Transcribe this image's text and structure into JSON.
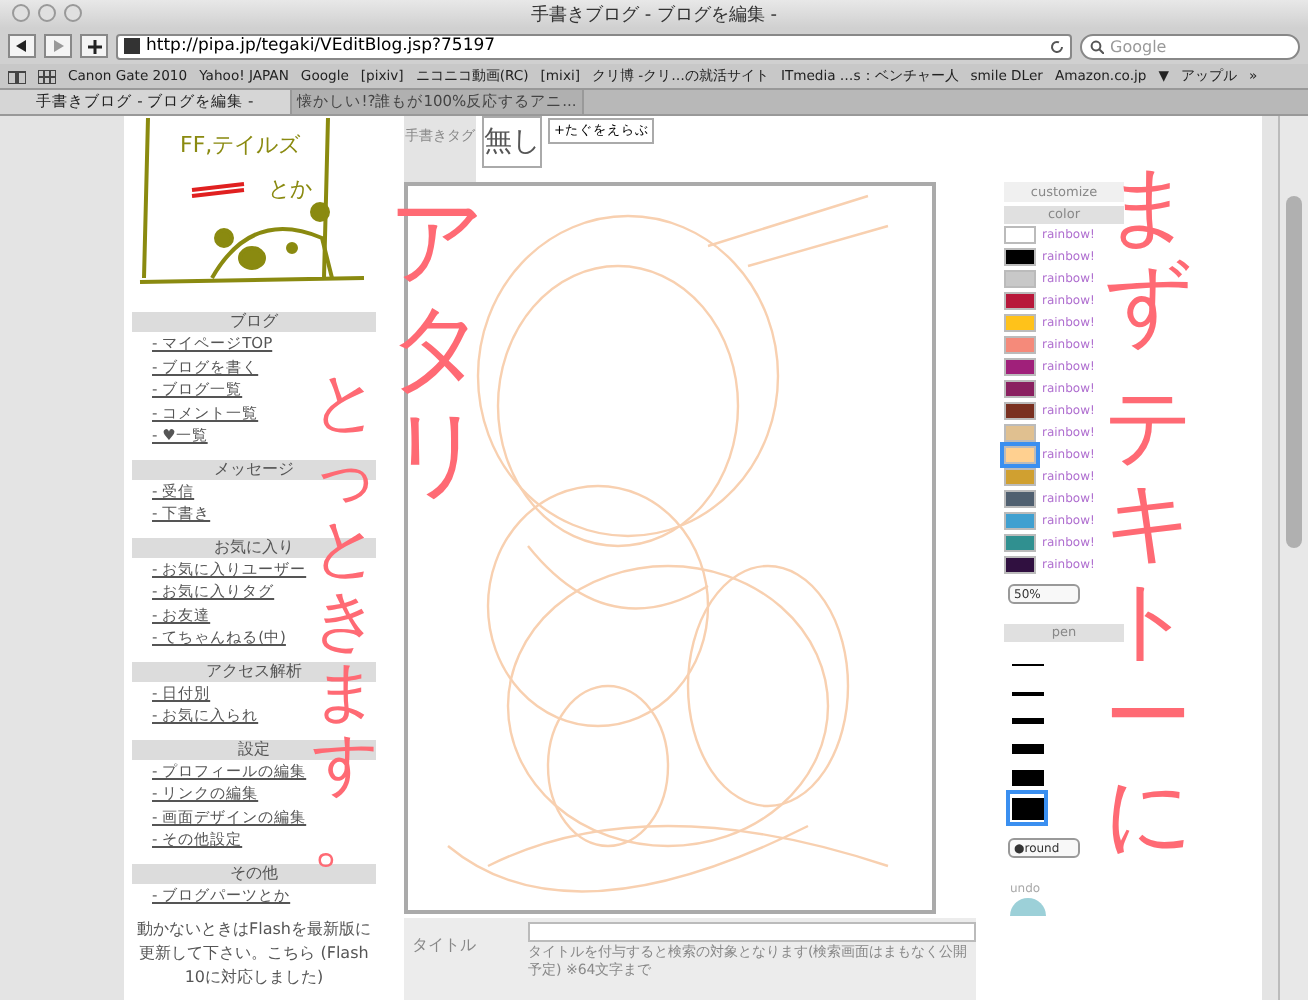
{
  "window": {
    "title": "手書きブログ - ブログを編集 -"
  },
  "toolbar": {
    "url": "http://pipa.jp/tegaki/VEditBlog.jsp?75197",
    "search_placeholder": "Google"
  },
  "bookmarks": [
    "Canon Gate 2010",
    "Yahoo! JAPAN",
    "Google",
    "[pixiv]",
    "ニコニコ動画(RC)",
    "[mixi]",
    "クリ博 -クリ…の就活サイト",
    "ITmedia …s：ベンチャー人",
    "smile DLer",
    "Amazon.co.jp",
    "▼",
    "アップル",
    "»"
  ],
  "tabs": [
    {
      "label": "手書きブログ - ブログを編集 -",
      "selected": true
    },
    {
      "label": "懐かしい!?誰もが100%反応するアニ...",
      "selected": false
    }
  ],
  "logo": {
    "texts": [
      "FF,テイルズ",
      "とか"
    ]
  },
  "sidebar": [
    {
      "title": "ブログ",
      "items": [
        "- マイページTOP",
        "- ブログを書く",
        "- ブログ一覧",
        "- コメント一覧",
        "- ♥一覧"
      ]
    },
    {
      "title": "メッセージ",
      "items": [
        "- 受信",
        "- 下書き"
      ]
    },
    {
      "title": "お気に入り",
      "items": [
        "- お気に入りユーザー",
        "- お気に入りタグ",
        "- お友達",
        "- てちゃんねる(中)"
      ]
    },
    {
      "title": "アクセス解析",
      "items": [
        "- 日付別",
        "- お気に入られ"
      ]
    },
    {
      "title": "設定",
      "items": [
        "- プロフィールの編集",
        "- リンクの編集",
        "- 画面デザインの編集",
        "- その他設定"
      ]
    },
    {
      "title": "その他",
      "items": [
        "- ブログパーツとか"
      ]
    }
  ],
  "notice": {
    "text": "動かないときはFlashを最新版に更新して下さい。",
    "link": "こちら",
    "note": "(Flash 10に対応しました)"
  },
  "tags": {
    "label": "手書きタグ",
    "current": "無し",
    "button": "+たぐをえらぶ"
  },
  "palette": {
    "customize": "customize",
    "color_header": "color",
    "colors": [
      {
        "color": "#ffffff",
        "label": "rainbow!",
        "selected": false
      },
      {
        "color": "#000000",
        "label": "rainbow!",
        "selected": false
      },
      {
        "color": "#c8c8c8",
        "label": "rainbow!",
        "selected": false
      },
      {
        "color": "#b8183a",
        "label": "rainbow!",
        "selected": false
      },
      {
        "color": "#ffc21a",
        "label": "rainbow!",
        "selected": false
      },
      {
        "color": "#f58a7a",
        "label": "rainbow!",
        "selected": false
      },
      {
        "color": "#a0207a",
        "label": "rainbow!",
        "selected": false
      },
      {
        "color": "#8a2060",
        "label": "rainbow!",
        "selected": false
      },
      {
        "color": "#7a3020",
        "label": "rainbow!",
        "selected": false
      },
      {
        "color": "#e0c090",
        "label": "rainbow!",
        "selected": false
      },
      {
        "color": "#ffd090",
        "label": "rainbow!",
        "selected": true
      },
      {
        "color": "#d0a030",
        "label": "rainbow!",
        "selected": false
      },
      {
        "color": "#506070",
        "label": "rainbow!",
        "selected": false
      },
      {
        "color": "#40a0d0",
        "label": "rainbow!",
        "selected": false
      },
      {
        "color": "#309090",
        "label": "rainbow!",
        "selected": false
      },
      {
        "color": "#301040",
        "label": "rainbow!",
        "selected": false
      }
    ],
    "opacity": "50%",
    "pen_header": "pen",
    "pens": [
      {
        "selected": false
      },
      {
        "selected": false
      },
      {
        "selected": false
      },
      {
        "selected": false
      },
      {
        "selected": false
      },
      {
        "selected": true
      }
    ],
    "pen_shape": "●round",
    "undo": "undo"
  },
  "title_field": {
    "label": "タイトル",
    "hint": "タイトルを付与すると検索の対象となります(検索画面はまもなく公開予定) ※64文字まで"
  },
  "annotations": [
    "とっときます。",
    "アタリ",
    "まず",
    "テキトーに"
  ]
}
